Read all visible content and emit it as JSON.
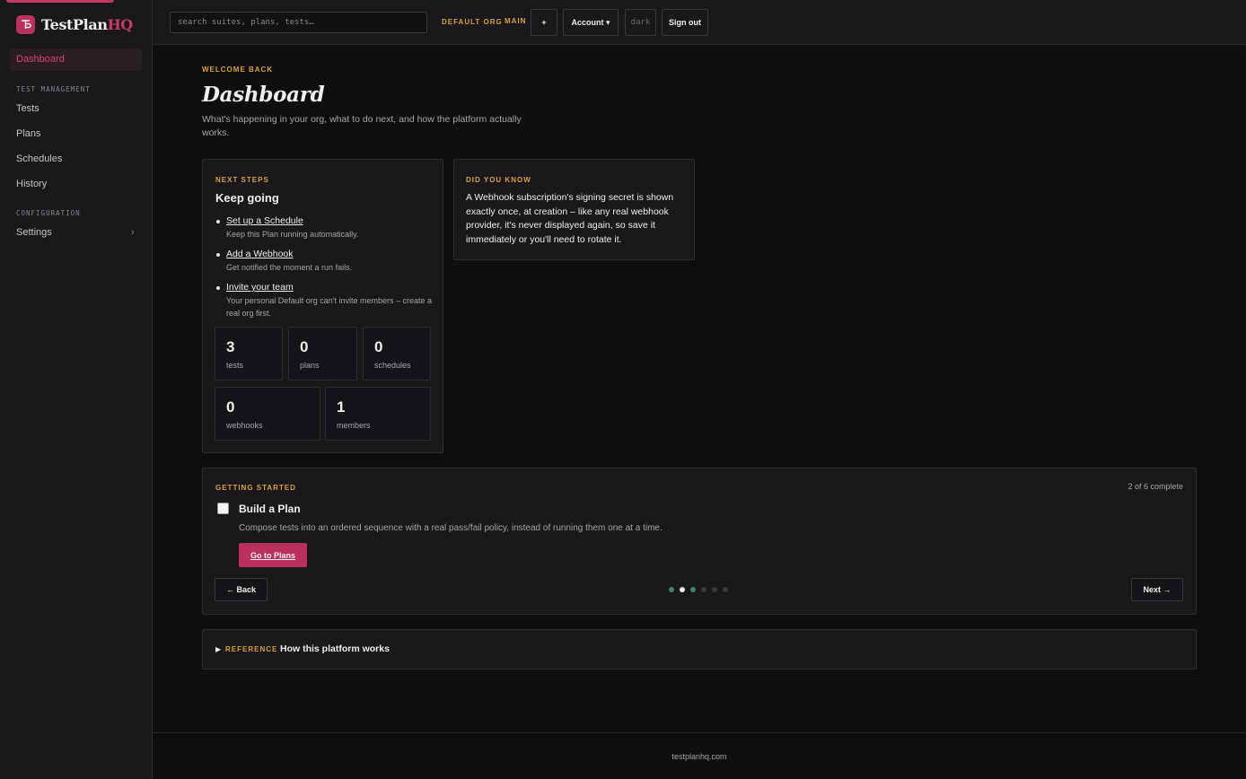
{
  "brand": {
    "name_main": "TestPlan",
    "name_accent": "HQ"
  },
  "sidebar": {
    "active_item": "Dashboard",
    "sections": [
      {
        "title": "TEST MANAGEMENT",
        "items": [
          "Tests",
          "Plans",
          "Schedules",
          "History"
        ]
      },
      {
        "title": "CONFIGURATION",
        "items": [
          "Settings"
        ]
      }
    ]
  },
  "topbar": {
    "search_placeholder": "search suites, plans, tests…",
    "org": "DEFAULT ORG",
    "branch": "MAIN",
    "plus_label": "+",
    "account_label": "Account ▾",
    "theme_label": "dark",
    "signout_label": "Sign out"
  },
  "page": {
    "eyebrow": "WELCOME BACK",
    "title": "Dashboard",
    "subtitle": "What's happening in your org, what to do next, and how the platform actually works."
  },
  "next_steps": {
    "eyebrow": "NEXT STEPS",
    "heading": "Keep going",
    "items": [
      {
        "link": "Set up a Schedule",
        "desc": "Keep this Plan running automatically."
      },
      {
        "link": "Add a Webhook",
        "desc": "Get notified the moment a run fails."
      },
      {
        "link": "Invite your team",
        "desc": "Your personal Default org can't invite members – create a real org first."
      }
    ],
    "stats": [
      {
        "value": "3",
        "label": "tests"
      },
      {
        "value": "0",
        "label": "plans"
      },
      {
        "value": "0",
        "label": "schedules"
      },
      {
        "value": "0",
        "label": "webhooks"
      },
      {
        "value": "1",
        "label": "members"
      }
    ]
  },
  "did_you_know": {
    "eyebrow": "DID YOU KNOW",
    "text": "A Webhook subscription's signing secret is shown exactly once, at creation – like any real webhook provider, it's never displayed again, so save it immediately or you'll need to rotate it."
  },
  "getting_started": {
    "eyebrow": "GETTING STARTED",
    "progress": "2 of 6 complete",
    "step_title": "Build a Plan",
    "step_desc": "Compose tests into an ordered sequence with a real pass/fail policy, instead of running them one at a time.",
    "cta_label": "Go to Plans",
    "back_label": "← Back",
    "next_label": "Next →",
    "dot_colors": [
      "#3f8a6a",
      "#f1ecf2",
      "#3f8a6a",
      "#3a3540",
      "#3a3540",
      "#3a3540"
    ]
  },
  "reference": {
    "eyebrow": "REFERENCE",
    "title": "How this platform works"
  },
  "footer": {
    "text": "testplanhq.com"
  }
}
